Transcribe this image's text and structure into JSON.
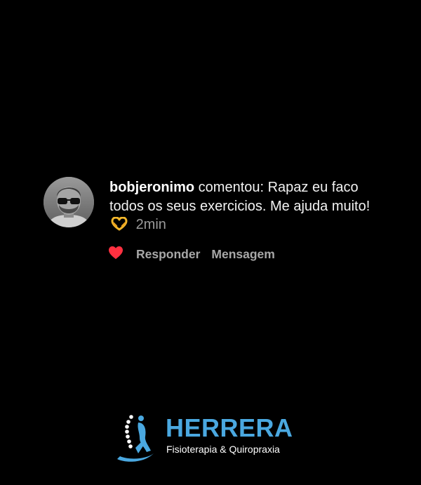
{
  "comment": {
    "username": "bobjeronimo",
    "text_before_emoji": " comentou: Rapaz eu faco todos os seus exercicios. Me ajuda muito!",
    "emoji": "heart-hands-emoji",
    "time": "2min",
    "avatar_icon": "profile-photo-man-sunglasses"
  },
  "actions": {
    "like_icon": "heart-icon",
    "like_color": "#ff3040",
    "reply_label": "Responder",
    "message_label": "Mensagem"
  },
  "brand": {
    "name": "HERRERA",
    "tagline": "Fisioterapia & Quiropraxia",
    "accent_color": "#4aa8e0",
    "logo_icon": "spine-figure-logo"
  }
}
